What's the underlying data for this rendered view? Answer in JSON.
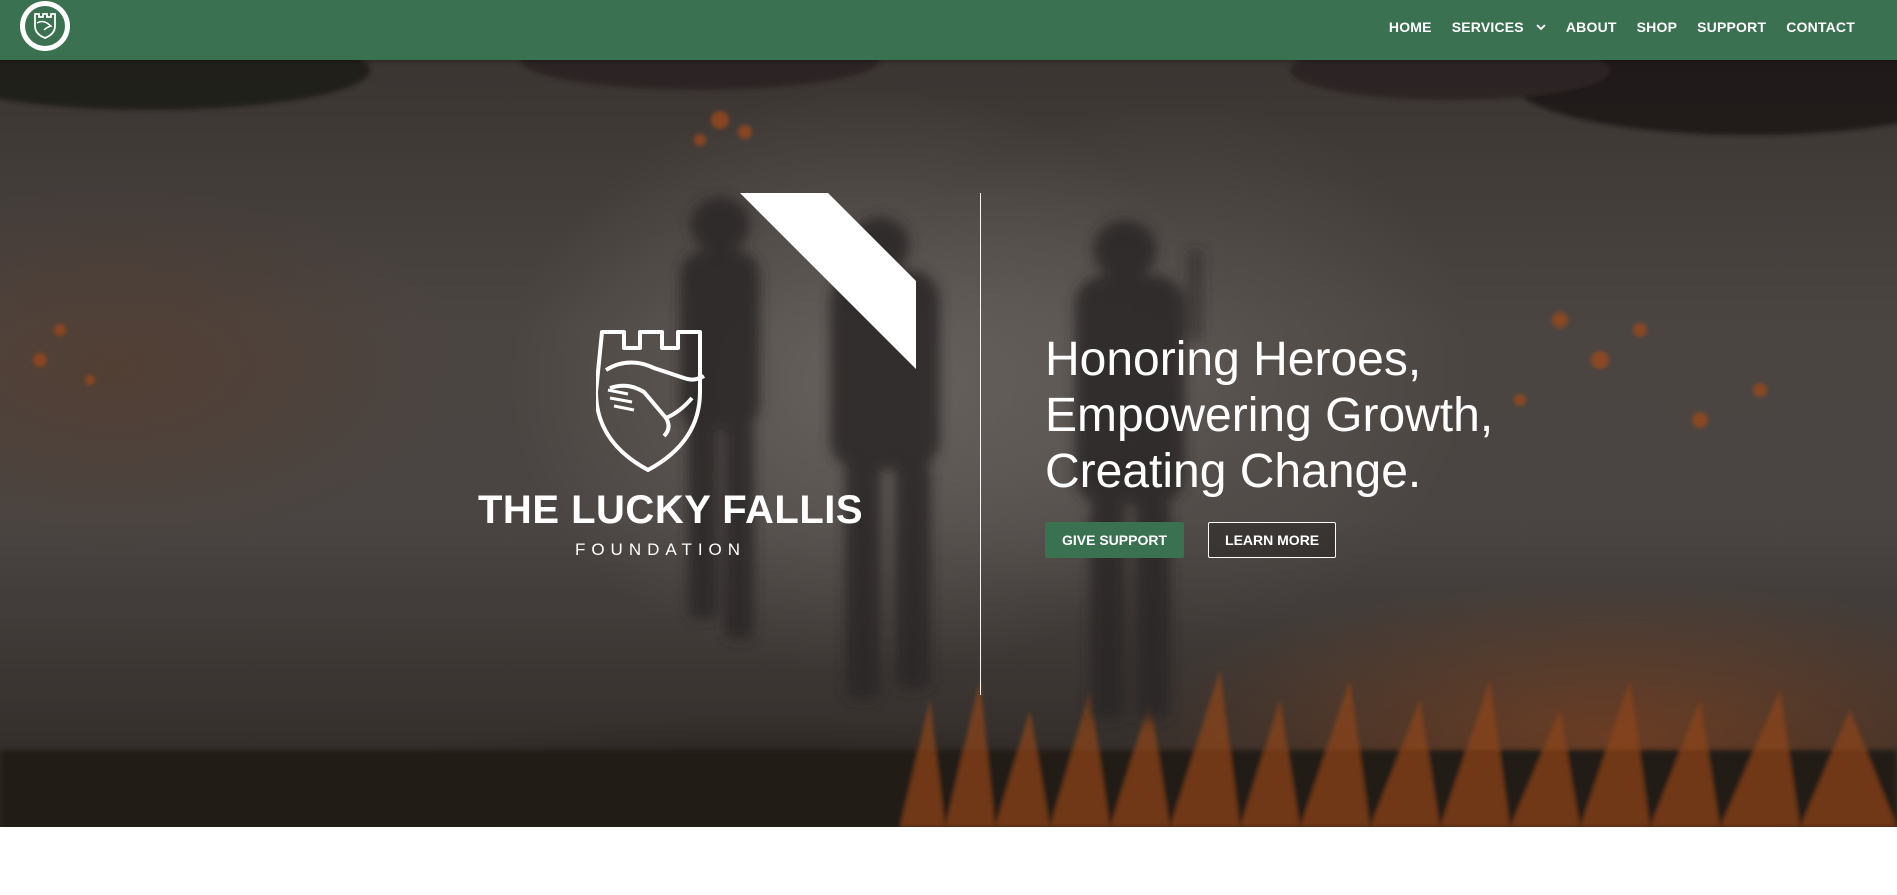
{
  "nav": {
    "logo_icon": "shield-tower-handshake-icon",
    "items": [
      {
        "label": "HOME"
      },
      {
        "label": "SERVICES",
        "has_dropdown": true
      },
      {
        "label": "ABOUT"
      },
      {
        "label": "SHOP"
      },
      {
        "label": "SUPPORT"
      },
      {
        "label": "CONTACT"
      }
    ]
  },
  "hero": {
    "brand": {
      "name": "THE LUCKY FALLIS",
      "sub": "FOUNDATION",
      "emblem_icon": "shield-tower-handshake-icon"
    },
    "headline": [
      "Honoring Heroes,",
      "Empowering Growth,",
      "Creating Change."
    ],
    "buttons": {
      "primary": "GIVE SUPPORT",
      "secondary": "LEARN MORE"
    }
  },
  "colors": {
    "brand_green": "#3a7150",
    "text_light": "#ffffff"
  }
}
